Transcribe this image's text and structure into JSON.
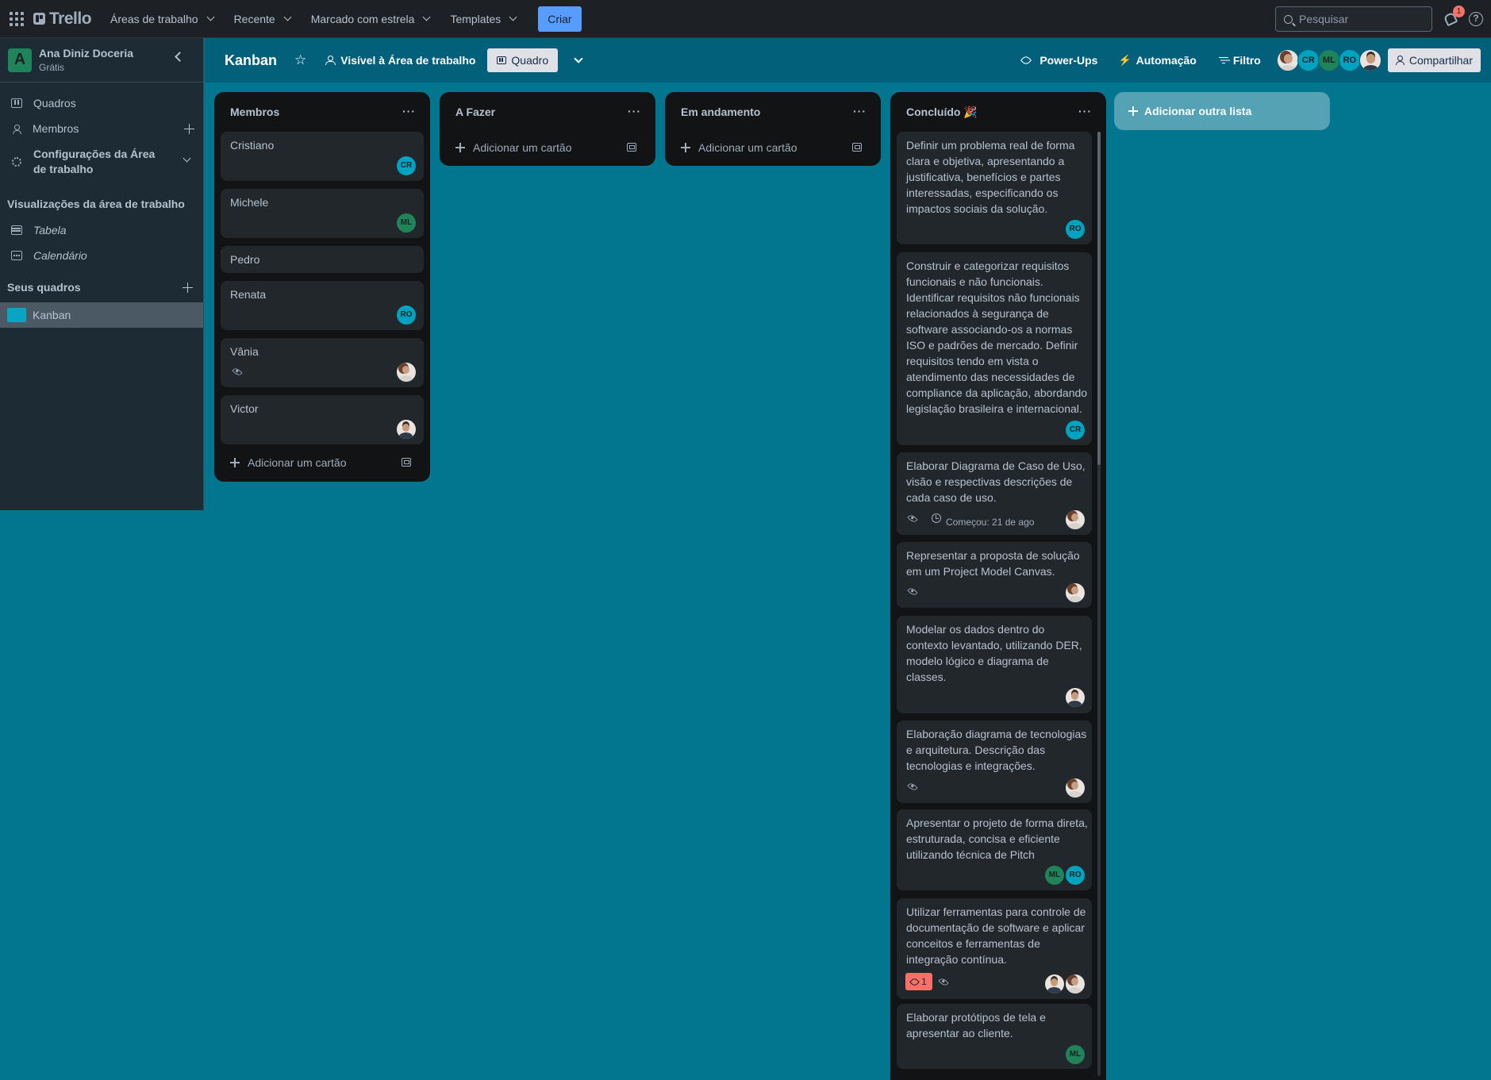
{
  "topbar": {
    "logo": "Trello",
    "menus": [
      "Áreas de trabalho",
      "Recente",
      "Marcado com estrela",
      "Templates"
    ],
    "create_label": "Criar",
    "search_placeholder": "Pesquisar",
    "notification_count": "1",
    "help_glyph": "?"
  },
  "sidebar": {
    "workspace_initial": "A",
    "workspace_name": "Ana Diniz Doceria",
    "workspace_plan": "Grátis",
    "items": [
      {
        "label": "Quadros",
        "icon": "board-icon"
      },
      {
        "label": "Membros",
        "icon": "person-icon"
      },
      {
        "label": "Configurações da Área de trabalho",
        "icon": "gear-icon"
      }
    ],
    "views_heading": "Visualizações da área de trabalho",
    "views": [
      {
        "label": "Tabela",
        "icon": "table-icon"
      },
      {
        "label": "Calendário",
        "icon": "calendar-icon"
      }
    ],
    "boards_heading": "Seus quadros",
    "boards": [
      {
        "label": "Kanban",
        "color": "#0aa5c2"
      }
    ]
  },
  "board": {
    "title": "Kanban",
    "visibility": "Visível à Área de trabalho",
    "view": "Quadro",
    "powerups": "Power-Ups",
    "automation": "Automação",
    "filter": "Filtro",
    "share": "Compartilhar",
    "member_initials": [
      "CR",
      "ML",
      "RO"
    ]
  },
  "lists": [
    {
      "title": "Membros",
      "cards": [
        {
          "text": "Cristiano",
          "members": [
            "CR"
          ]
        },
        {
          "text": "Michele",
          "members": [
            "ML"
          ]
        },
        {
          "text": "Pedro",
          "members": []
        },
        {
          "text": "Renata",
          "members": [
            "RO"
          ]
        },
        {
          "text": "Vânia",
          "members": [
            "photo-female"
          ],
          "watching": true
        },
        {
          "text": "Victor",
          "members": [
            "photo-male"
          ]
        }
      ],
      "add_card": "Adicionar um cartão"
    },
    {
      "title": "A Fazer",
      "cards": [],
      "add_card": "Adicionar um cartão"
    },
    {
      "title": "Em andamento",
      "cards": [],
      "add_card": "Adicionar um cartão"
    },
    {
      "title": "Concluído 🎉",
      "cards": [
        {
          "text": "Definir um problema real de forma clara e objetiva, apresentando a justificativa, benefícios e partes interessadas, especificando os impactos sociais da solução.",
          "members": [
            "RO"
          ]
        },
        {
          "text": "Construir e categorizar requisitos funcionais e não funcionais. Identificar requisitos não funcionais relacionados à segurança de software associando-os a normas ISO e padrões de mercado. Definir requisitos tendo em vista o atendimento das necessidades de compliance da aplicação, abordando legislação brasileira e internacional.",
          "members": [
            "CR"
          ]
        },
        {
          "text": "Elaborar Diagrama de Caso de Uso, visão e respectivas descrições de cada caso de uso.",
          "members": [
            "photo-female"
          ],
          "watching": true,
          "date": "Começou: 21 de ago"
        },
        {
          "text": "Representar a proposta de solução em um Project Model Canvas.",
          "members": [
            "photo-female"
          ],
          "watching": true
        },
        {
          "text": "Modelar os dados dentro do contexto levantado, utilizando DER, modelo lógico e diagrama de classes.",
          "members": [
            "photo-male"
          ]
        },
        {
          "text": "Elaboração diagrama de tecnologias e arquitetura. Descrição das tecnologias e integrações.",
          "members": [
            "photo-female"
          ],
          "watching": true
        },
        {
          "text": "Apresentar o projeto de forma direta, estruturada, concisa e eficiente utilizando técnica de Pitch",
          "members": [
            "ML",
            "RO"
          ]
        },
        {
          "text": "Utilizar ferramentas para controle de documentação de software e aplicar conceitos e ferramentas de integração contínua.",
          "members": [
            "photo-male",
            "photo-female"
          ],
          "watching": true,
          "comments": "1"
        },
        {
          "text": "Elaborar protótipos de tela e apresentar ao cliente.",
          "members": [
            "ML"
          ]
        }
      ]
    }
  ],
  "add_list": "Adicionar outra lista",
  "colors": {
    "board_bg": "#03768f",
    "header_bg": "#03607a",
    "create": "#579dff",
    "cr": "#00a3bf",
    "ml": "#1f845a",
    "ro": "#00a3bf",
    "comment_badge": "#f87168"
  }
}
